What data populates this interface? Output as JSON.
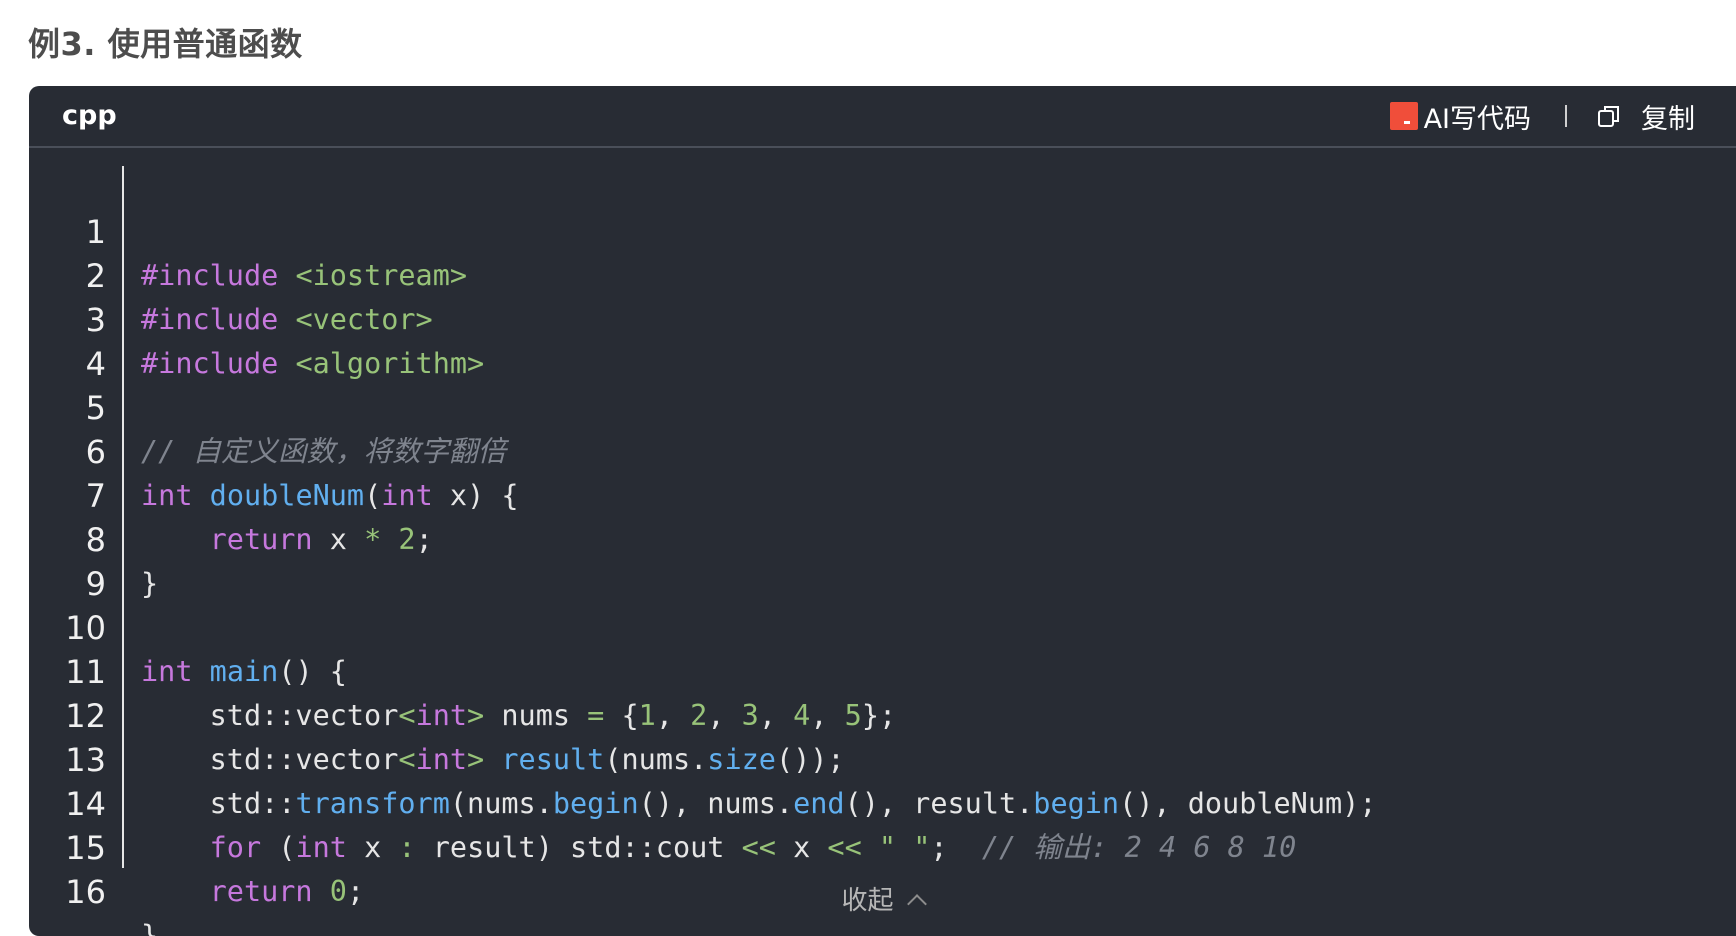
{
  "section": {
    "title": "例3. 使用普通函数"
  },
  "code_block": {
    "language": "cpp",
    "ai_label": "AI写代码",
    "copy_label": "复制",
    "collapse_label": "收起",
    "lines": [
      "1",
      "2",
      "3",
      "4",
      "5",
      "6",
      "7",
      "8",
      "9",
      "10",
      "11",
      "12",
      "13",
      "14",
      "15",
      "16"
    ],
    "source": [
      "#include <iostream>",
      "#include <vector>",
      "#include <algorithm>",
      "",
      "// 自定义函数，将数字翻倍",
      "int doubleNum(int x) {",
      "    return x * 2;",
      "}",
      "",
      "int main() {",
      "    std::vector<int> nums = {1, 2, 3, 4, 5};",
      "    std::vector<int> result(nums.size());",
      "    std::transform(nums.begin(), nums.end(), result.begin(), doubleNum);",
      "    for (int x : result) std::cout << x << \" \";  // 输出: 2 4 6 8 10",
      "    return 0;",
      "}"
    ]
  },
  "icons": {
    "ai": "ai-code-icon",
    "copy": "copy-icon",
    "collapse": "chevron-up-icon"
  },
  "colors": {
    "code_bg": "#282c34",
    "keyword": "#c678dd",
    "function": "#61afef",
    "string": "#98c379",
    "comment": "#7f848e",
    "ai_icon": "#f04e3a"
  }
}
